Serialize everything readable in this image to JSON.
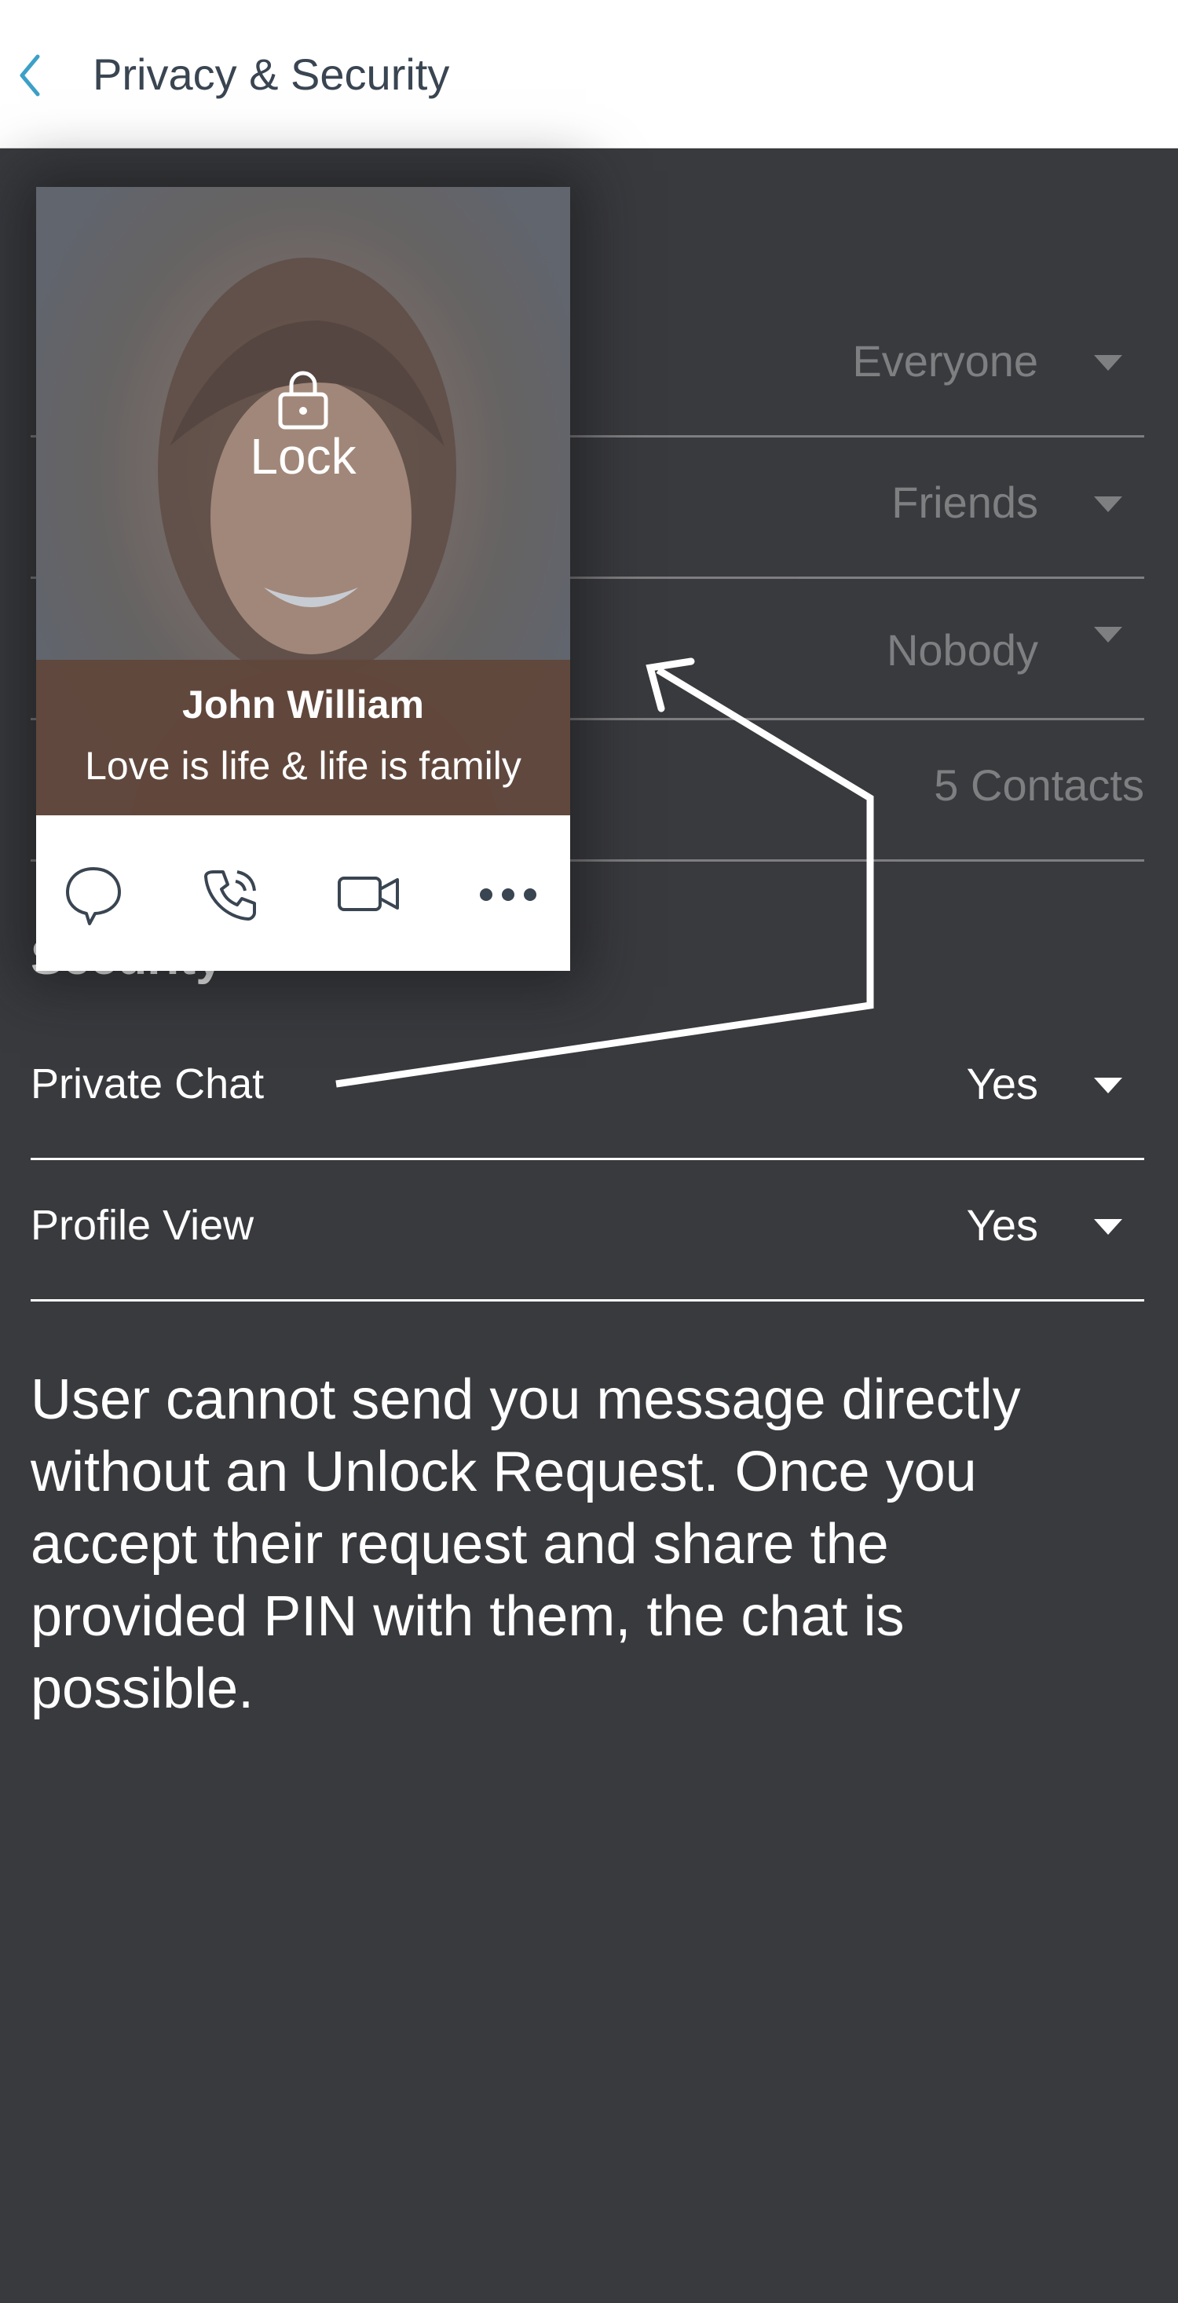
{
  "header": {
    "title": "Privacy & Security"
  },
  "privacy_rows": [
    {
      "value": "Everyone"
    },
    {
      "value": "Friends"
    },
    {
      "value": "Nobody"
    },
    {
      "value": "5 Contacts"
    }
  ],
  "security": {
    "heading": "Security",
    "rows": [
      {
        "label": "Private Chat",
        "value": "Yes"
      },
      {
        "label": "Profile View",
        "value": "Yes"
      }
    ]
  },
  "description": "User cannot send you message directly without an Unlock Request. Once you accept their request and share the provided PIN with them, the chat is possible.",
  "profile_card": {
    "lock_label": "Lock",
    "name": "John William",
    "bio": "Love is life & life is family",
    "actions": [
      "chat-bubble-icon",
      "phone-icon",
      "video-camera-icon",
      "more-dots-icon"
    ]
  },
  "colors": {
    "background": "#393a3e",
    "header_bg": "#ffffff",
    "accent": "#3ca0c8",
    "title_text": "#3a4552"
  }
}
